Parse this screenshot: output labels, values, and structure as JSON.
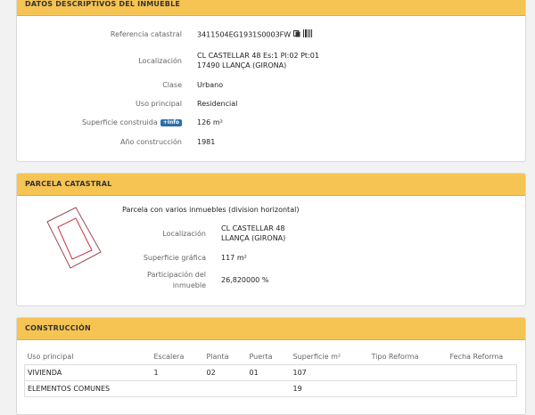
{
  "datos": {
    "header": "DATOS DESCRIPTIVOS DEL INMUEBLE",
    "ref_label": "Referencia catastral",
    "ref_value": "3411504EG1931S0003FW",
    "loc_label": "Localización",
    "loc_line1": "CL CASTELLAR 48 Es:1 Pl:02 Pt:01",
    "loc_line2": "17490 LLANÇA (GIRONA)",
    "clase_label": "Clase",
    "clase_value": "Urbano",
    "uso_label": "Uso principal",
    "uso_value": "Residencial",
    "sup_label": "Superficie construida",
    "info_badge": "+Info",
    "sup_value": "126 m²",
    "anio_label": "Año construcción",
    "anio_value": "1981"
  },
  "parcela": {
    "header": "PARCELA CATASTRAL",
    "desc": "Parcela con varios inmuebles (division horizontal)",
    "loc_label": "Localización",
    "loc_line1": "CL CASTELLAR 48",
    "loc_line2": "LLANÇA (GIRONA)",
    "sup_label": "Superficie gráfica",
    "sup_value": "117 m²",
    "part_label1": "Participación del",
    "part_label2": "inmueble",
    "part_value": "26,820000 %"
  },
  "construccion": {
    "header": "CONSTRUCCIÓN",
    "columns": [
      "Uso principal",
      "Escalera",
      "Planta",
      "Puerta",
      "Superficie m²",
      "Tipo Reforma",
      "Fecha Reforma"
    ],
    "rows": [
      [
        "VIVIENDA",
        "1",
        "02",
        "01",
        "107",
        "",
        ""
      ],
      [
        "ELEMENTOS COMUNES",
        "",
        "",
        "",
        "19",
        "",
        ""
      ]
    ]
  },
  "icons": [
    "copy-icon",
    "barcode-icon"
  ],
  "colors": {
    "header": "#f6c453",
    "badge": "#2e6ea6",
    "parcel_outline": "#cc3344"
  }
}
